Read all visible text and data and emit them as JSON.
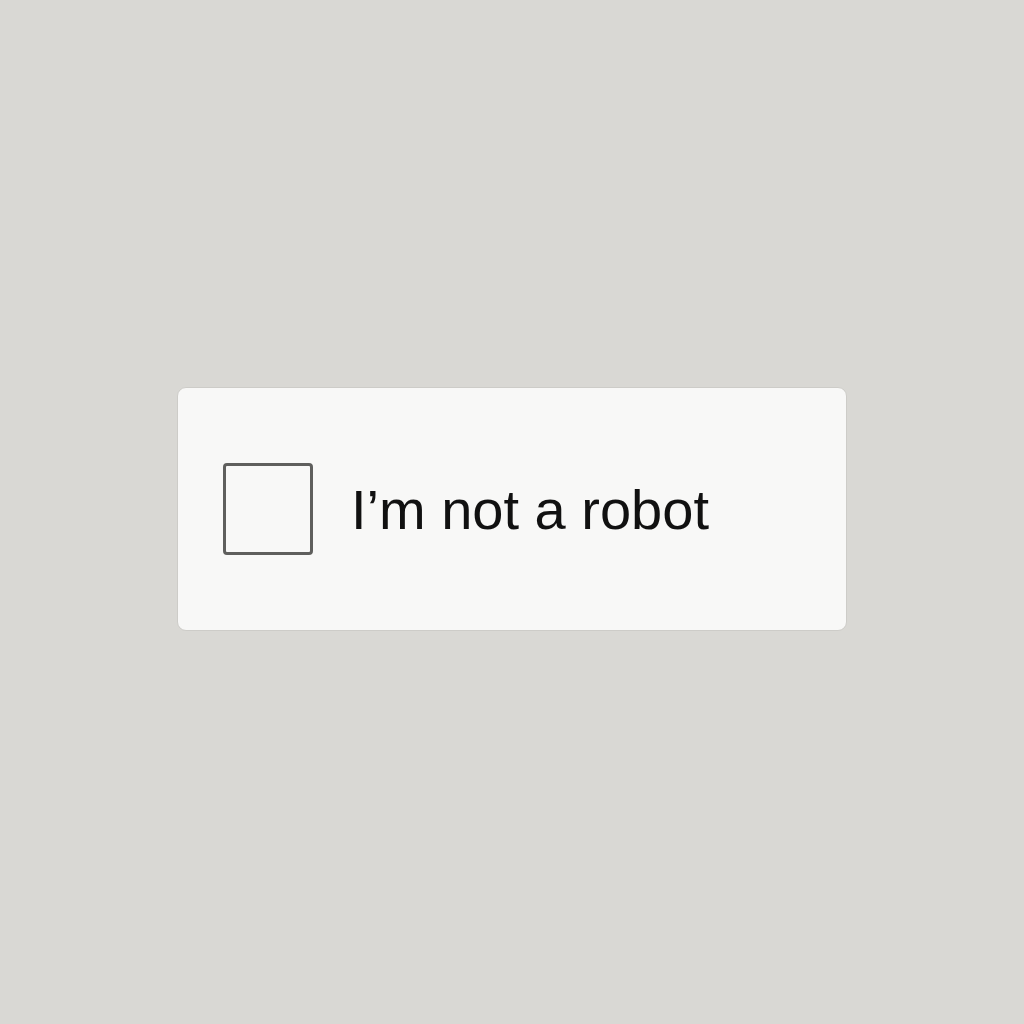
{
  "checkbox": {
    "label": "I’m not a robot",
    "checked": false
  }
}
